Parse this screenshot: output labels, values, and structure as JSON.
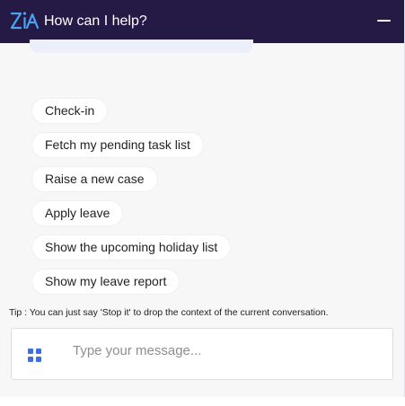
{
  "header": {
    "title": "How can I help?",
    "logo_icon": "zia-logo-icon",
    "minimize_icon": "minimize-icon",
    "background": "#251a45"
  },
  "suggestions": [
    {
      "label": "Check-in"
    },
    {
      "label": "Fetch my pending task list"
    },
    {
      "label": "Raise a new case"
    },
    {
      "label": "Apply leave"
    },
    {
      "label": "Show the upcoming holiday list"
    },
    {
      "label": "Show my leave report"
    }
  ],
  "tip": {
    "text": "Tip : You can just say 'Stop it' to drop the context of the current conversation."
  },
  "composer": {
    "placeholder": "Type your message...",
    "value": "",
    "menu_icon": "grid-menu-icon",
    "accent": "#3d6fe0"
  }
}
